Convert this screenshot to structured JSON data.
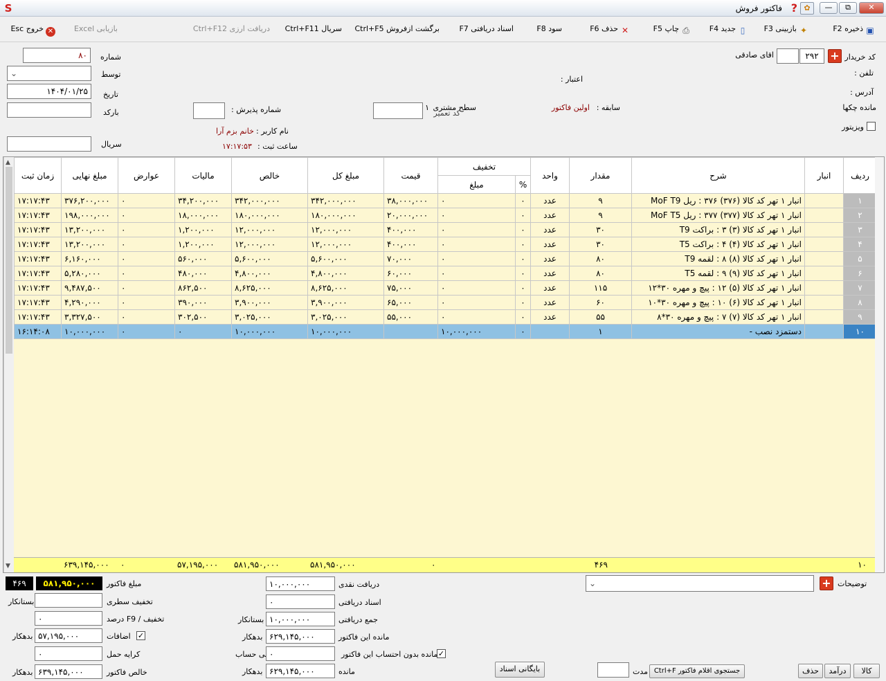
{
  "window": {
    "title": "فاکتور فروش",
    "app_icon": "app-logo",
    "help_icon": "help-icon",
    "restore": "⧉",
    "minimize": "—",
    "close": "✕"
  },
  "toolbar": {
    "save": "ذخیره F2",
    "review": "بازبینی F3",
    "new": "جدید F4",
    "print": "چاپ F5",
    "delete": "حذف F6",
    "profit": "سود F8",
    "received_docs": "اسناد دریافتی F7",
    "return": "برگشت ازفروش Ctrl+F5",
    "serial": "سریال Ctrl+F11",
    "currency": "دریافت ارزی Ctrl+F12",
    "excel": "بازیابی Excel",
    "exit": "خروج Esc"
  },
  "header": {
    "buyer_code_label": "کد خریدار",
    "buyer_code": "۲۹۲",
    "buyer_name": "اقای صادقی",
    "phone_label": "تلفن :",
    "credit_label": "اعتبار :",
    "address_label": "آدرس :",
    "cheques_label": "مانده چکها",
    "history_label": "سابقه :",
    "history_value": "اولین فاکتور",
    "customer_level_label": "سطح مشتری",
    "customer_level_value": "۱",
    "editor_code_label": "کد تعمیر",
    "visitor_label": "ویزیتور",
    "number_label": "شماره",
    "number_value": "۸۰",
    "by_label": "توسط",
    "date_label": "تاریخ",
    "date_value": "۱۴۰۴/۰۱/۲۵",
    "barcode_label": "بارکد",
    "serial_label": "سریال",
    "reception_label": "شماره پذیرش :",
    "username_label": "نام کاربر :",
    "username_value": "خانم بزم آرا",
    "reg_time_label": "ساعت ثبت :",
    "reg_time_value": "۱۷:۱۷:۵۳"
  },
  "grid": {
    "columns": {
      "row": "ردیف",
      "store": "انبار",
      "desc": "شرح",
      "qty": "مقدار",
      "unit": "واحد",
      "discount": "تخفیف",
      "disc_pct": "%",
      "disc_amt": "مبلغ",
      "price": "قیمت",
      "total": "مبلغ کل",
      "net": "خالص",
      "tax": "مالیات",
      "duties": "عوارض",
      "final": "مبلغ نهایی",
      "time": "زمان ثبت"
    },
    "rows": [
      {
        "row": "۱",
        "store": "",
        "desc": "انبار ۱ تهر کد کالا (۳۷۶) ۳۷۶ : ریل  MoF  T9",
        "qty": "۹",
        "unit": "عدد",
        "pct": "۰",
        "amt": "۰",
        "price": "۳۸,۰۰۰,۰۰۰",
        "total": "۳۴۲,۰۰۰,۰۰۰",
        "net": "۳۴۲,۰۰۰,۰۰۰",
        "tax": "۳۴,۲۰۰,۰۰۰",
        "duties": "۰",
        "final": "۳۷۶,۲۰۰,۰۰۰",
        "time": "۱۷:۱۷:۴۳"
      },
      {
        "row": "۲",
        "store": "",
        "desc": "انبار ۱ تهر کد کالا (۳۷۷) ۳۷۷ : ریل  MoF  T5",
        "qty": "۹",
        "unit": "عدد",
        "pct": "۰",
        "amt": "۰",
        "price": "۲۰,۰۰۰,۰۰۰",
        "total": "۱۸۰,۰۰۰,۰۰۰",
        "net": "۱۸۰,۰۰۰,۰۰۰",
        "tax": "۱۸,۰۰۰,۰۰۰",
        "duties": "۰",
        "final": "۱۹۸,۰۰۰,۰۰۰",
        "time": "۱۷:۱۷:۴۳"
      },
      {
        "row": "۳",
        "store": "",
        "desc": "انبار ۱ تهر کد کالا (۳) ۳ : براکت T9",
        "qty": "۳۰",
        "unit": "عدد",
        "pct": "۰",
        "amt": "۰",
        "price": "۴۰۰,۰۰۰",
        "total": "۱۲,۰۰۰,۰۰۰",
        "net": "۱۲,۰۰۰,۰۰۰",
        "tax": "۱,۲۰۰,۰۰۰",
        "duties": "۰",
        "final": "۱۳,۲۰۰,۰۰۰",
        "time": "۱۷:۱۷:۴۳"
      },
      {
        "row": "۴",
        "store": "",
        "desc": "انبار ۱ تهر کد کالا (۴) ۴ : براکت T5",
        "qty": "۳۰",
        "unit": "عدد",
        "pct": "۰",
        "amt": "۰",
        "price": "۴۰۰,۰۰۰",
        "total": "۱۲,۰۰۰,۰۰۰",
        "net": "۱۲,۰۰۰,۰۰۰",
        "tax": "۱,۲۰۰,۰۰۰",
        "duties": "۰",
        "final": "۱۳,۲۰۰,۰۰۰",
        "time": "۱۷:۱۷:۴۳"
      },
      {
        "row": "۵",
        "store": "",
        "desc": "انبار ۱ تهر کد کالا (۸) ۸ : لقمه T9",
        "qty": "۸۰",
        "unit": "عدد",
        "pct": "۰",
        "amt": "۰",
        "price": "۷۰,۰۰۰",
        "total": "۵,۶۰۰,۰۰۰",
        "net": "۵,۶۰۰,۰۰۰",
        "tax": "۵۶۰,۰۰۰",
        "duties": "۰",
        "final": "۶,۱۶۰,۰۰۰",
        "time": "۱۷:۱۷:۴۳"
      },
      {
        "row": "۶",
        "store": "",
        "desc": "انبار ۱ تهر کد کالا (۹) ۹ : لقمه T5",
        "qty": "۸۰",
        "unit": "عدد",
        "pct": "۰",
        "amt": "۰",
        "price": "۶۰,۰۰۰",
        "total": "۴,۸۰۰,۰۰۰",
        "net": "۴,۸۰۰,۰۰۰",
        "tax": "۴۸۰,۰۰۰",
        "duties": "۰",
        "final": "۵,۲۸۰,۰۰۰",
        "time": "۱۷:۱۷:۴۳"
      },
      {
        "row": "۷",
        "store": "",
        "desc": "انبار ۱ تهر کد کالا (۵) ۱۲ : پیچ و مهره ۳۰*۱۲",
        "qty": "۱۱۵",
        "unit": "عدد",
        "pct": "۰",
        "amt": "۰",
        "price": "۷۵,۰۰۰",
        "total": "۸,۶۲۵,۰۰۰",
        "net": "۸,۶۲۵,۰۰۰",
        "tax": "۸۶۲,۵۰۰",
        "duties": "۰",
        "final": "۹,۴۸۷,۵۰۰",
        "time": "۱۷:۱۷:۴۳"
      },
      {
        "row": "۸",
        "store": "",
        "desc": "انبار ۱ تهر کد کالا (۶) ۱۰ : پیچ و مهره ۳۰*۱۰",
        "qty": "۶۰",
        "unit": "عدد",
        "pct": "۰",
        "amt": "۰",
        "price": "۶۵,۰۰۰",
        "total": "۳,۹۰۰,۰۰۰",
        "net": "۳,۹۰۰,۰۰۰",
        "tax": "۳۹۰,۰۰۰",
        "duties": "۰",
        "final": "۴,۲۹۰,۰۰۰",
        "time": "۱۷:۱۷:۴۳"
      },
      {
        "row": "۹",
        "store": "",
        "desc": "انبار ۱ تهر کد کالا (۷) ۷ : پیچ و مهره ۳۰*۸",
        "qty": "۵۵",
        "unit": "عدد",
        "pct": "۰",
        "amt": "۰",
        "price": "۵۵,۰۰۰",
        "total": "۳,۰۲۵,۰۰۰",
        "net": "۳,۰۲۵,۰۰۰",
        "tax": "۳۰۲,۵۰۰",
        "duties": "۰",
        "final": "۳,۳۲۷,۵۰۰",
        "time": "۱۷:۱۷:۴۳"
      },
      {
        "row": "۱۰",
        "store": "",
        "desc": "دستمزد نصب -",
        "qty": "۱",
        "unit": "",
        "pct": "۰",
        "amt": "۱۰,۰۰۰,۰۰۰",
        "price": "",
        "total": "۱۰,۰۰۰,۰۰۰",
        "net": "۱۰,۰۰۰,۰۰۰",
        "tax": "۰",
        "duties": "۰",
        "final": "۱۰,۰۰۰,۰۰۰",
        "time": "۱۶:۱۴:۰۸"
      }
    ],
    "totals": {
      "count": "۱۰",
      "qty": "۴۶۹",
      "disc_amt": "۰",
      "total": "۵۸۱,۹۵۰,۰۰۰",
      "net": "۵۸۱,۹۵۰,۰۰۰",
      "tax": "۵۷,۱۹۵,۰۰۰",
      "duties": "۰",
      "final": "۶۳۹,۱۴۵,۰۰۰"
    }
  },
  "footer": {
    "invoice_amount_label": "مبلغ فاکتور",
    "invoice_amount": "۵۸۱,۹۵۰,۰۰۰",
    "invoice_count": "۴۶۹",
    "line_discount_label": "تخفیف سطری",
    "creditor": "بستانکار",
    "discount_pct_label": "تخفیف / F9 درصد",
    "discount_pct_value": "۰",
    "additions_label": "اضافات",
    "additions_value": "۵۷,۱۹۵,۰۰۰",
    "debtor": "بدهکار",
    "freight_label": "کرایه حمل",
    "freight_value": "۰",
    "net_invoice_label": "خالص فاکتور",
    "net_invoice_value": "۶۳۹,۱۴۵,۰۰۰",
    "cash_label": "دریافت نقدی",
    "cash_value": "۱۰,۰۰۰,۰۰۰",
    "recv_docs_label": "اسناد دریافتی",
    "recv_docs_value": "۰",
    "recv_total_label": "جمع دریافتی",
    "recv_total_value": "۱۰,۰۰۰,۰۰۰",
    "this_balance_label": "مانده این فاکتور",
    "this_balance_value": "۶۲۹,۱۴۵,۰۰۰",
    "no_calc_label": "مانده بدون احتساب این فاکتور",
    "no_calc_value": "۰",
    "no_account": "بی حساب",
    "balance_label": "مانده",
    "balance_value": "۶۲۹,۱۴۵,۰۰۰",
    "notes_label": "توضیحات",
    "archive_button": "بایگانی اسناد",
    "duration_label": "مدت",
    "search_items": "جستجوی اقلام فاکتور Ctrl+F",
    "goods_button": "کالا",
    "income_button": "درآمد",
    "delete_button": "حذف"
  }
}
